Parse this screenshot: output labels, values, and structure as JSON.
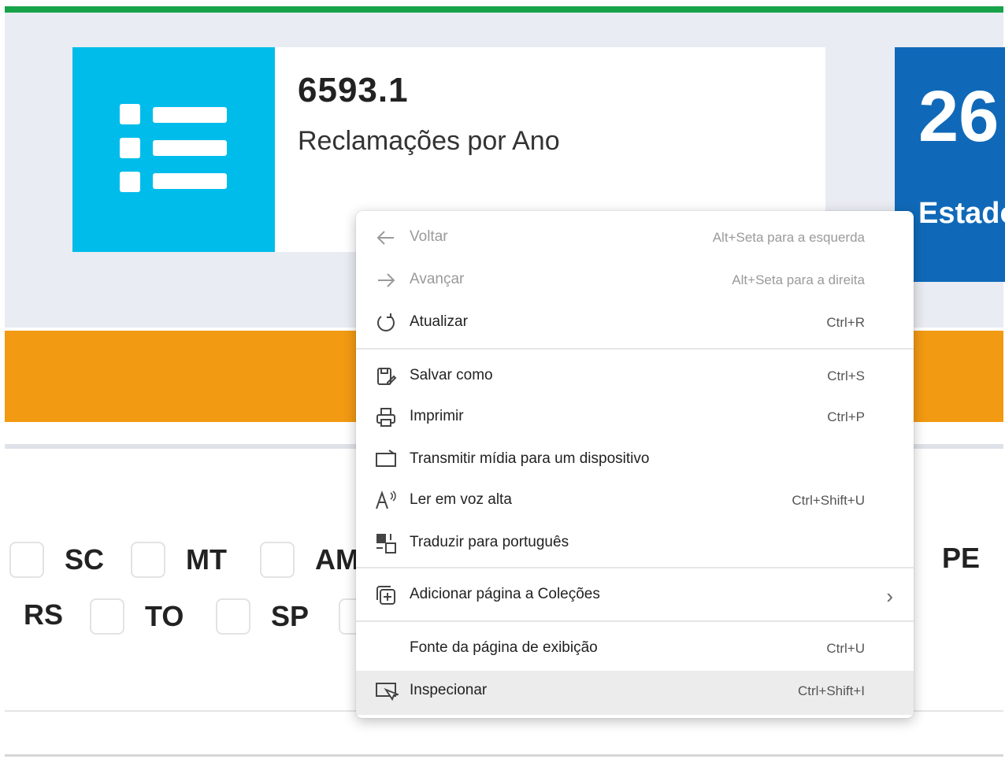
{
  "card_complaints": {
    "value": "6593.1",
    "label": "Reclamações por Ano"
  },
  "card_states": {
    "value": "26",
    "label": "Estado"
  },
  "states": {
    "row1": [
      "SC",
      "MT",
      "AM",
      "PE"
    ],
    "row2": [
      "RS",
      "TO",
      "SP"
    ]
  },
  "context_menu": {
    "back": {
      "label": "Voltar",
      "shortcut": "Alt+Seta para a esquerda"
    },
    "forward": {
      "label": "Avançar",
      "shortcut": "Alt+Seta para a direita"
    },
    "reload": {
      "label": "Atualizar",
      "shortcut": "Ctrl+R"
    },
    "save_as": {
      "label": "Salvar como",
      "shortcut": "Ctrl+S"
    },
    "print": {
      "label": "Imprimir",
      "shortcut": "Ctrl+P"
    },
    "cast": {
      "label": "Transmitir mídia para um dispositivo"
    },
    "read_aloud": {
      "label": "Ler em voz alta",
      "shortcut": "Ctrl+Shift+U"
    },
    "translate": {
      "label": "Traduzir para português"
    },
    "collections": {
      "label": "Adicionar página a Coleções"
    },
    "view_source": {
      "label": "Fonte da página de exibição",
      "shortcut": "Ctrl+U"
    },
    "inspect": {
      "label": "Inspecionar",
      "shortcut": "Ctrl+Shift+I"
    }
  },
  "colors": {
    "green_bar": "#16a34a",
    "cyan_card": "#00bcea",
    "blue_card": "#1069b8",
    "orange_bar": "#f29a12"
  }
}
